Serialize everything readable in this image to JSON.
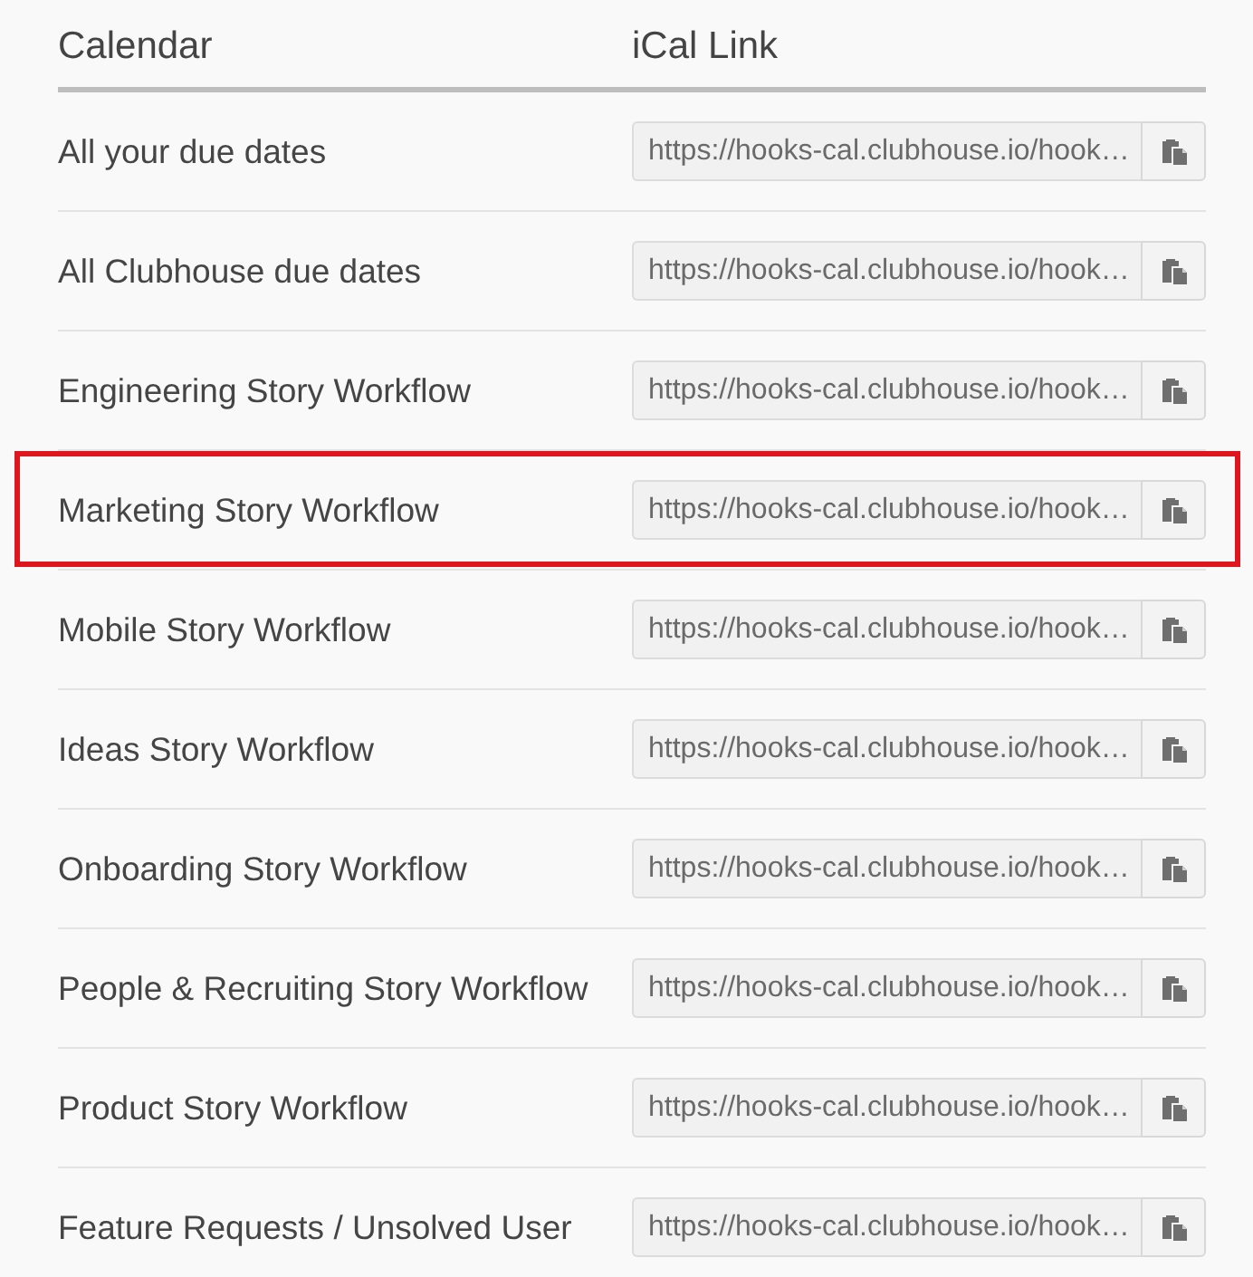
{
  "table": {
    "columns": [
      "Calendar",
      "iCal Link"
    ],
    "rows": [
      {
        "calendar": "All your due dates",
        "ical_link": "https://hooks-cal.clubhouse.io/hook…",
        "highlighted": false
      },
      {
        "calendar": "All Clubhouse due dates",
        "ical_link": "https://hooks-cal.clubhouse.io/hook…",
        "highlighted": false
      },
      {
        "calendar": "Engineering Story Workflow",
        "ical_link": "https://hooks-cal.clubhouse.io/hook…",
        "highlighted": false
      },
      {
        "calendar": "Marketing Story Workflow",
        "ical_link": "https://hooks-cal.clubhouse.io/hook…",
        "highlighted": true
      },
      {
        "calendar": "Mobile Story Workflow",
        "ical_link": "https://hooks-cal.clubhouse.io/hook…",
        "highlighted": false
      },
      {
        "calendar": "Ideas Story Workflow",
        "ical_link": "https://hooks-cal.clubhouse.io/hook…",
        "highlighted": false
      },
      {
        "calendar": "Onboarding Story Workflow",
        "ical_link": "https://hooks-cal.clubhouse.io/hook…",
        "highlighted": false
      },
      {
        "calendar": "People & Recruiting Story Workflow",
        "ical_link": "https://hooks-cal.clubhouse.io/hook…",
        "highlighted": false
      },
      {
        "calendar": "Product Story Workflow",
        "ical_link": "https://hooks-cal.clubhouse.io/hook…",
        "highlighted": false
      },
      {
        "calendar": "Feature Requests / Unsolved User",
        "ical_link": "https://hooks-cal.clubhouse.io/hook…",
        "highlighted": false
      }
    ]
  }
}
